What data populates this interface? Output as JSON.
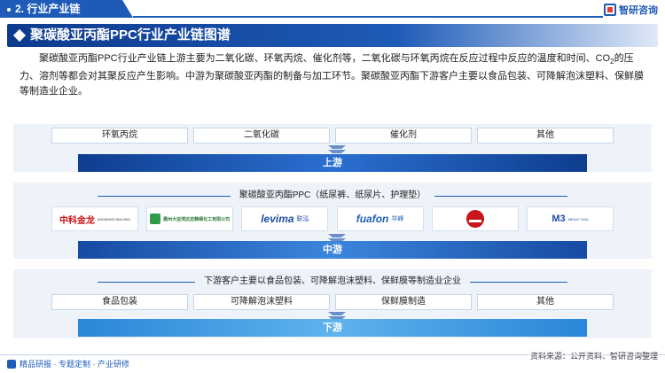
{
  "header": {
    "section": "2. 行业产业链",
    "brand": "智研咨询"
  },
  "title": "聚碳酸亚丙酯PPC行业产业链图谱",
  "intro_parts": {
    "a": "聚碳酸亚丙酯PPC行业产业链上游主要为二氧化碳、环氧丙烷、催化剂等，二氧化碳与环氧丙烷在反应过程中反应的温度和时间、CO",
    "sub": "2",
    "b": "的压力、溶剂等都会对其聚反应产生影响。中游为聚碳酸亚丙酯的制备与加工环节。聚碳酸亚丙酯下游客户主要以食品包装、可降解泡沫塑料、保鲜膜等制造业企业。"
  },
  "upstream": {
    "items": [
      "环氧丙烷",
      "二氧化碳",
      "催化剂",
      "其他"
    ],
    "stage_label": "上游"
  },
  "midstream": {
    "label": "聚碳酸亚丙酯PPC（纸尿裤、纸尿片、护理垫）",
    "logos": [
      {
        "name": "中科金龙",
        "sub": "ZHONGKEJINLONG"
      },
      {
        "name": "惠州大亚湾达志精细化工有限公司"
      },
      {
        "name": "levima",
        "sub": "联泓"
      },
      {
        "name": "fuafon",
        "sub": "华峰"
      },
      {
        "name": ""
      },
      {
        "name": "M3",
        "sub": "MEILIC SGA"
      }
    ],
    "stage_label": "中游"
  },
  "downstream": {
    "label": "下游客户主要以食品包装、可降解泡沫塑料、保鲜膜等制造业企业",
    "items": [
      "食品包装",
      "可降解泡沫塑料",
      "保鲜膜制造",
      "其他"
    ],
    "stage_label": "下游"
  },
  "footer": {
    "left": "精品研报 · 专题定制 · 产业研修",
    "source": "资料来源：公开资料、智研咨询整理"
  }
}
